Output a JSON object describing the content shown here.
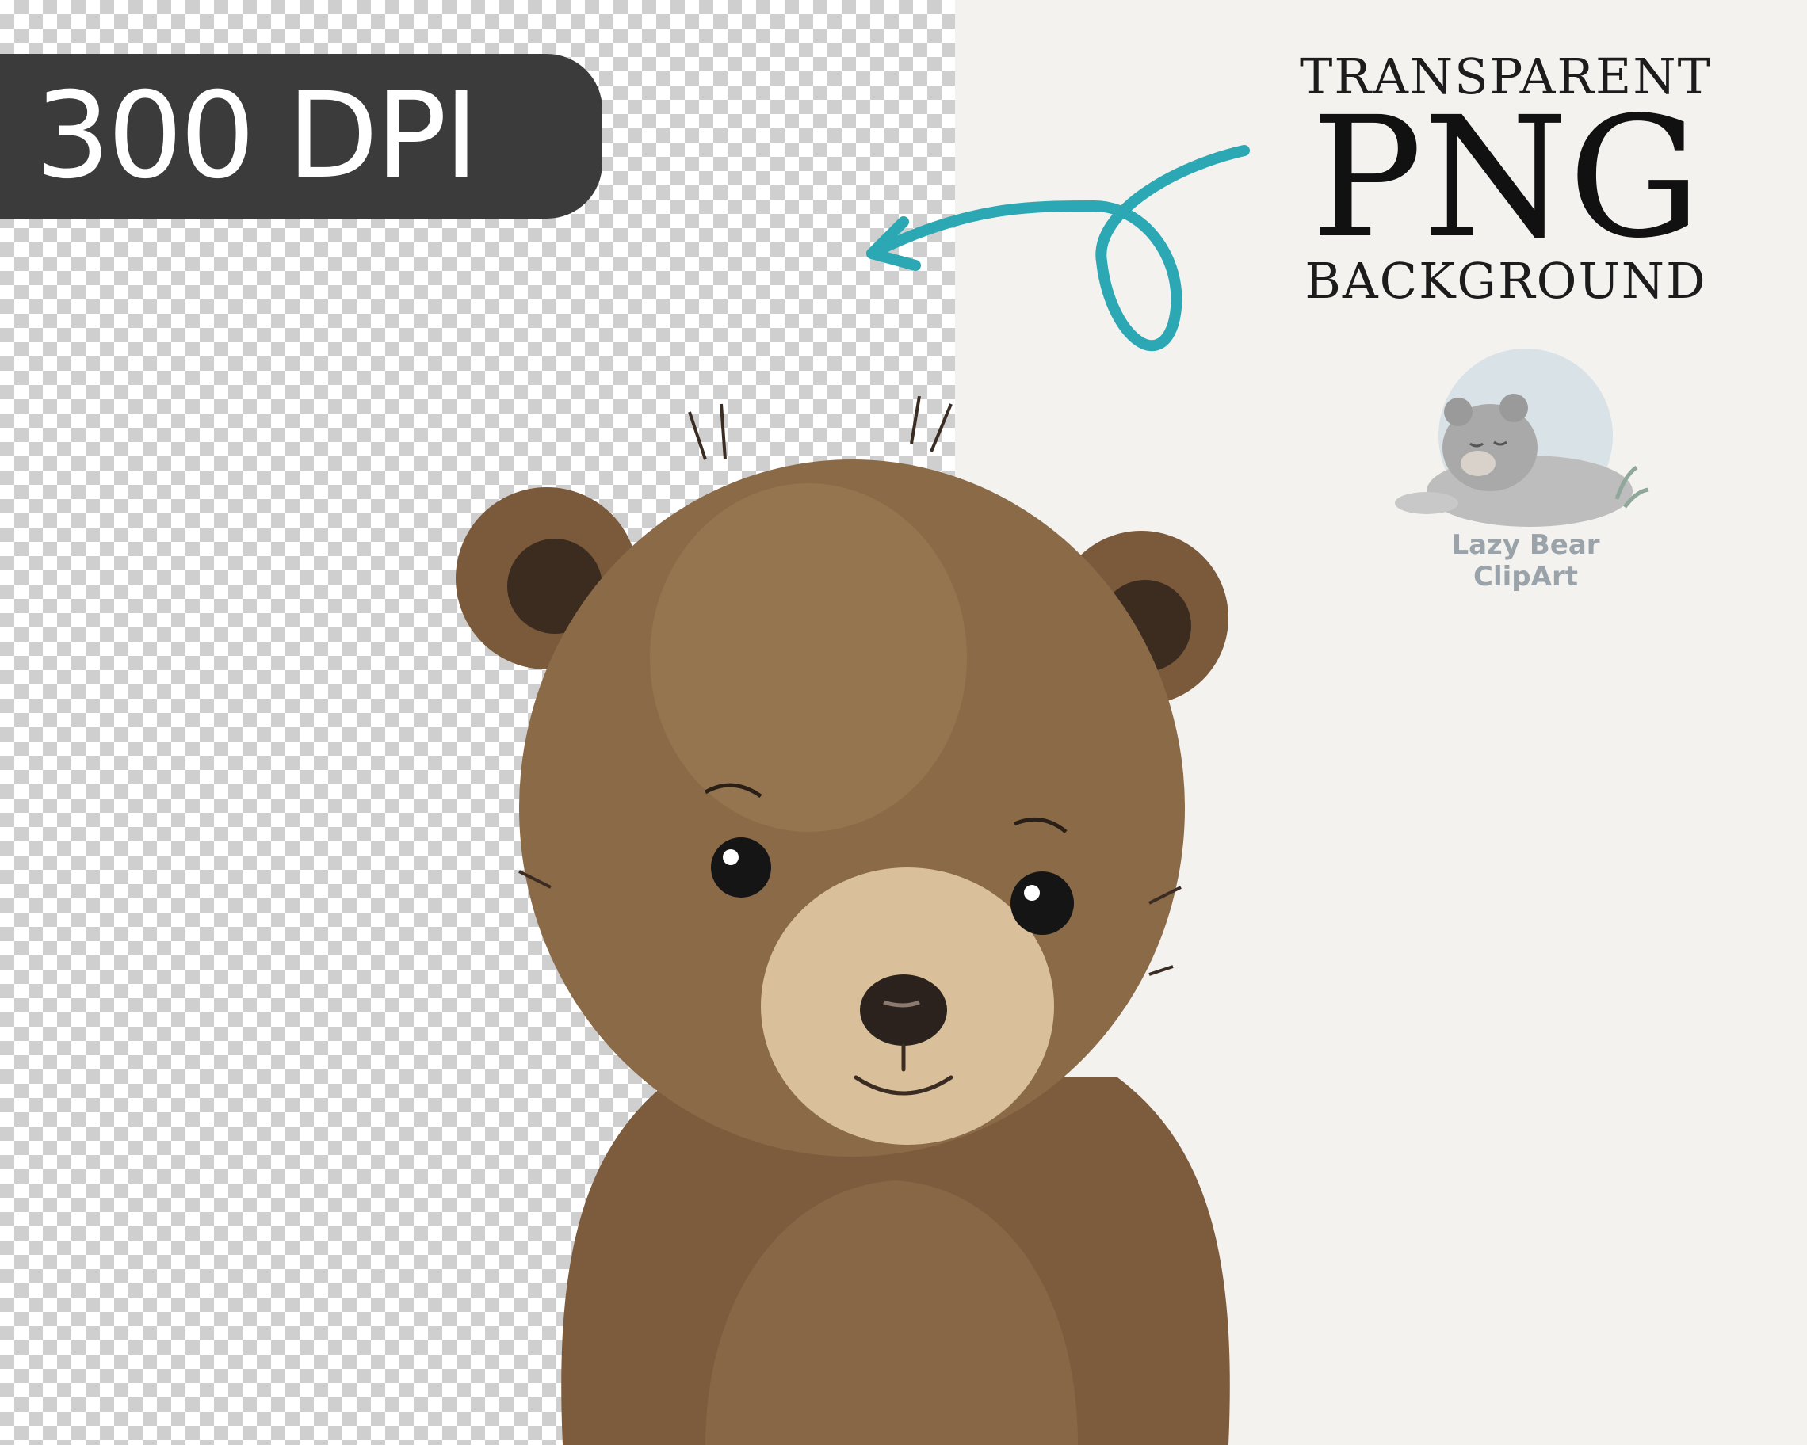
{
  "badge": {
    "text": "300 DPI"
  },
  "heading": {
    "line1": "TRANSPARENT",
    "line2": "PNG",
    "line3": "BACKGROUND"
  },
  "logo": {
    "name": "Lazy Bear ClipArt"
  },
  "colors": {
    "arrow": "#2ba8b3",
    "badge_bg": "#3b3b3b",
    "bear_fur": "#8a6a47"
  }
}
